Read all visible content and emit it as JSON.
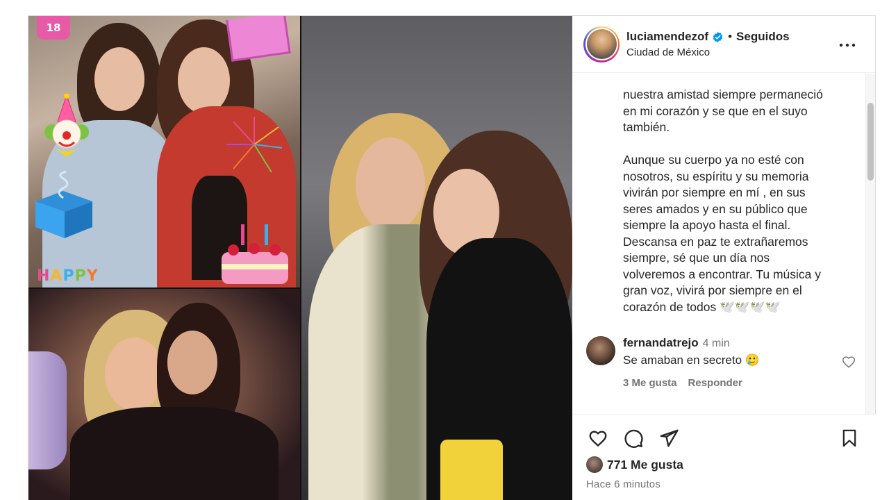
{
  "header": {
    "username": "luciamendezof",
    "separator": "•",
    "follow_state": "Seguidos",
    "location": "Ciudad de México"
  },
  "caption": {
    "paragraph1": "nuestra amistad siempre permaneció\nen mi corazón y se que en el suyo\ntambién.",
    "paragraph2": "Aunque su cuerpo ya no esté con\nnosotros, su espíritu y su memoria\nvivirán por siempre en mí , en sus\nseres amados y en su público que\nsiempre la apoyo hasta el final.\nDescansa en paz te extrañaremos\nsiempre, sé que un día nos\nvolveremos a encontrar. Tu música y\ngran voz, vivirá por siempre en el\ncorazón de todos 🕊️🕊️🕊️🕊️"
  },
  "comments": [
    {
      "username": "fernandatrejo",
      "time": "4 min",
      "text": "Se amaban en secreto 🥲",
      "likes": "3 Me gusta",
      "reply_label": "Responder"
    }
  ],
  "footer": {
    "likes_count": "771 Me gusta",
    "time_ago": "Hace 6 minutos"
  },
  "media": {
    "sticker_happy": [
      "H",
      "A",
      "P",
      "P",
      "Y"
    ],
    "sticker_badge": "18"
  },
  "icons": {
    "verified": "verified-badge-icon",
    "more": "more-options-icon",
    "like": "heart-icon",
    "comment": "comment-bubble-icon",
    "share": "paper-plane-icon",
    "save": "bookmark-icon"
  },
  "colors": {
    "verified_blue": "#0095f6",
    "text": "#262626",
    "muted": "#737373"
  }
}
